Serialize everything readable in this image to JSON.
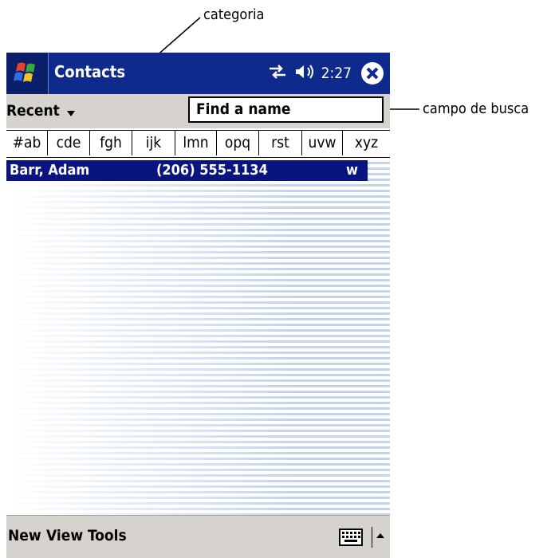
{
  "annotations": {
    "category": "categoria",
    "search_field": "campo de busca"
  },
  "title_bar": {
    "start_icon": "windows-flag-icon",
    "app_title": "Contacts",
    "status_icons": [
      "connectivity-icon",
      "speaker-icon"
    ],
    "clock": "2:27",
    "close_icon": "close-icon"
  },
  "toolbar": {
    "category": "Recent",
    "search_placeholder": "Find a name"
  },
  "alphabet_tabs": [
    "#ab",
    "cde",
    "fgh",
    "ijk",
    "lmn",
    "opq",
    "rst",
    "uvw",
    "xyz"
  ],
  "contacts": [
    {
      "name": "Barr, Adam",
      "phone": "(206) 555-1134",
      "type": "w"
    }
  ],
  "command_bar": {
    "menus": [
      "New",
      "View",
      "Tools"
    ],
    "input_icon": "keyboard-icon",
    "input_arrow_icon": "up-arrow-icon"
  },
  "colors": {
    "title_bar": "#0e2a8c",
    "toolbar": "#d6d3ce",
    "selection": "#0a1480",
    "list_stripe": "#c3d3ee"
  }
}
